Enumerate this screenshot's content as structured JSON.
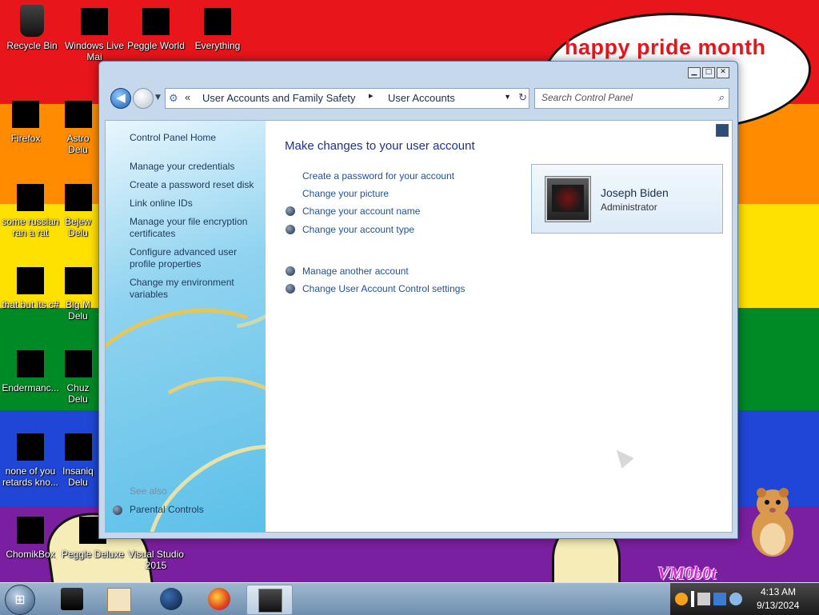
{
  "desktop": {
    "speech_bubble_text": "happy pride month",
    "watermark_text": "VM0b0t",
    "icons": [
      {
        "label": "Recycle Bin"
      },
      {
        "label": "Windows Live Mai"
      },
      {
        "label": "Peggle World"
      },
      {
        "label": "Everything"
      },
      {
        "label": "Firefox"
      },
      {
        "label": "Astro Delu"
      },
      {
        "label": "some russian ran a rat"
      },
      {
        "label": "Bejew Delu"
      },
      {
        "label": "that but its c#"
      },
      {
        "label": "Big M Delu"
      },
      {
        "label": "Endermanc..."
      },
      {
        "label": "Chuz Delu"
      },
      {
        "label": "none of you retards kno..."
      },
      {
        "label": "Insaniq Delu"
      },
      {
        "label": "ChomikBox"
      },
      {
        "label": "Peggle Deluxe"
      },
      {
        "label": "Visual Studio 2015"
      }
    ]
  },
  "window": {
    "controls": {
      "minimize": "▁",
      "maximize": "□",
      "close": "✕"
    },
    "nav": {
      "back_icon": "back-arrow-icon",
      "back_glyph": "◀",
      "breadcrumb": [
        "User Accounts and Family Safety",
        "User Accounts"
      ],
      "breadcrumb_separator": "▸",
      "chevrons": "«",
      "search_placeholder": "Search Control Panel"
    },
    "task_pane": {
      "home_link": "Control Panel Home",
      "links": [
        "Manage your credentials",
        "Create a password reset disk",
        "Link online IDs",
        "Manage your file encryption certificates",
        "Configure advanced user profile properties",
        "Change my environment variables"
      ],
      "see_also_label": "See also",
      "see_also_links": [
        "Parental Controls"
      ]
    },
    "main": {
      "title": "Make changes to your user account",
      "links": [
        "Create a password for your account",
        "Change your picture",
        "Change your account name",
        "Change your account type",
        "Manage another account",
        "Change User Account Control settings"
      ],
      "account": {
        "name": "Joseph Biden",
        "role": "Administrator"
      }
    }
  },
  "taskbar": {
    "clock_time": "4:13 AM",
    "clock_date": "9/13/2024"
  },
  "colors": {
    "link": "#1f5394",
    "title": "#1e3287",
    "bubble_text": "#e8151b"
  }
}
